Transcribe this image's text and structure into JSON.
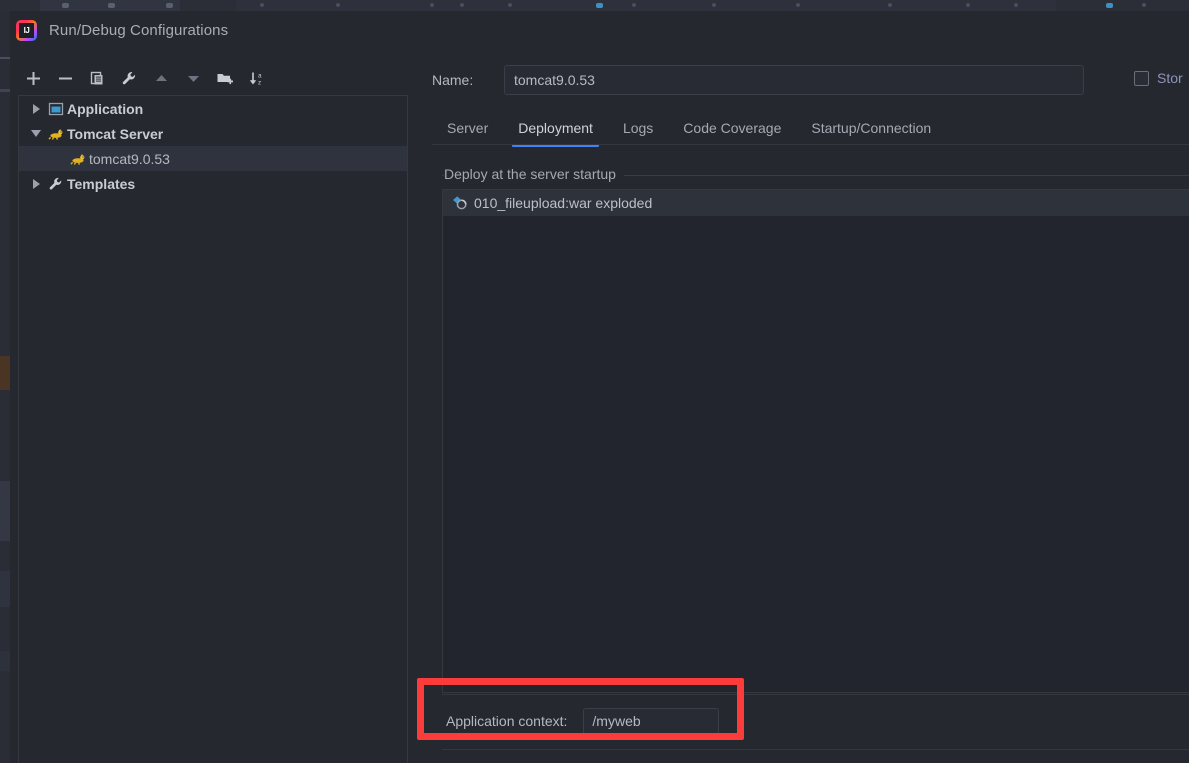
{
  "window": {
    "title": "Run/Debug Configurations",
    "logo_icon": "intellij-idea-logo"
  },
  "toolbar": {
    "buttons": [
      {
        "name": "add",
        "icon": "plus-icon",
        "label": "Add New Configuration"
      },
      {
        "name": "remove",
        "icon": "minus-icon",
        "label": "Remove Configuration"
      },
      {
        "name": "copy",
        "icon": "copy-icon",
        "label": "Copy Configuration"
      },
      {
        "name": "edit-templates",
        "icon": "wrench-icon",
        "label": "Edit Templates"
      },
      {
        "name": "move-up",
        "icon": "arrow-up-icon",
        "label": "Move Up"
      },
      {
        "name": "move-down",
        "icon": "arrow-down-icon",
        "label": "Move Down"
      },
      {
        "name": "new-folder",
        "icon": "folder-add-icon",
        "label": "New Folder"
      },
      {
        "name": "sort",
        "icon": "sort-az-icon",
        "label": "Sort Configurations"
      }
    ]
  },
  "tree": {
    "items": [
      {
        "label": "Application",
        "icon": "application-icon",
        "twisty": "right",
        "level": 0,
        "selected": false
      },
      {
        "label": "Tomcat Server",
        "icon": "tomcat-icon",
        "twisty": "down",
        "level": 0,
        "selected": false
      },
      {
        "label": "tomcat9.0.53",
        "icon": "tomcat-icon",
        "twisty": "none",
        "level": 1,
        "selected": true
      },
      {
        "label": "Templates",
        "icon": "wrench-icon",
        "twisty": "right",
        "level": 0,
        "selected": false
      }
    ]
  },
  "form": {
    "name_label": "Name:",
    "name_value": "tomcat9.0.53",
    "name_placeholder": "",
    "store_label": "Stor",
    "store_checked": false
  },
  "tabs": {
    "items": [
      {
        "label": "Server",
        "active": false
      },
      {
        "label": "Deployment",
        "active": true
      },
      {
        "label": "Logs",
        "active": false
      },
      {
        "label": "Code Coverage",
        "active": false
      },
      {
        "label": "Startup/Connection",
        "active": false
      }
    ],
    "active_underline_color": "#4382f5"
  },
  "deployment": {
    "group_title": "Deploy at the server startup",
    "items": [
      {
        "label": "010_fileupload:war exploded",
        "icon": "artifact-icon",
        "selected": true
      }
    ]
  },
  "application_context": {
    "label": "Application context:",
    "value": "/myweb",
    "placeholder": ""
  },
  "annotation": {
    "highlight_color": "#fc3b3b",
    "target": "application-context-field"
  },
  "colors": {
    "dialog_background": "#25282f",
    "panel_background": "#22252e",
    "selection_background": "#2f333d",
    "accent_blue": "#4382f5",
    "text_primary": "#bdc1c9",
    "text_secondary": "#a4a9b3",
    "border": "#35383f"
  }
}
